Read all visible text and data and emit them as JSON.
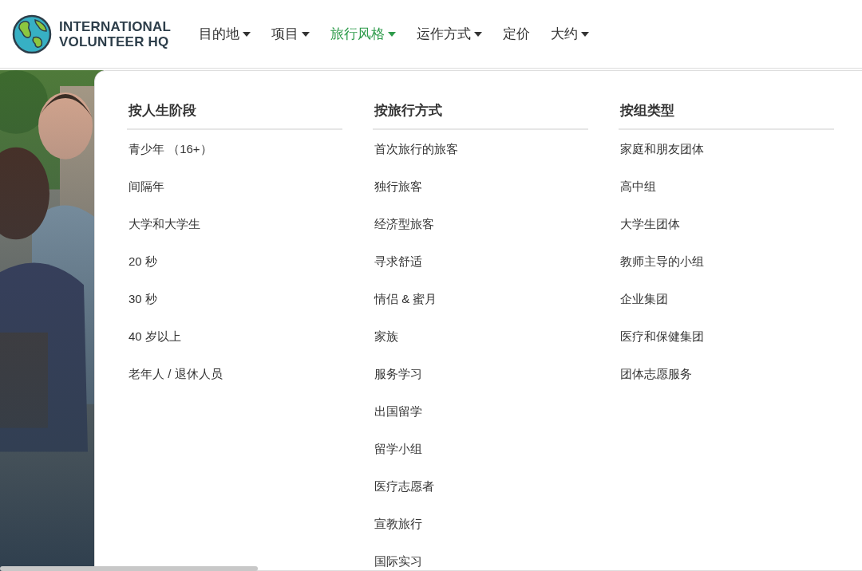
{
  "logo": {
    "line_1": "INTERNATIONAL",
    "line_2": "VOLUNTEER HQ"
  },
  "nav": [
    {
      "label": "目的地",
      "has_dropdown": true,
      "selected": false
    },
    {
      "label": "项目",
      "has_dropdown": true,
      "selected": false
    },
    {
      "label": "旅行风格",
      "has_dropdown": true,
      "selected": true
    },
    {
      "label": "运作方式",
      "has_dropdown": true,
      "selected": false
    },
    {
      "label": "定价",
      "has_dropdown": false,
      "selected": false
    },
    {
      "label": "大约",
      "has_dropdown": true,
      "selected": false
    }
  ],
  "dropdown": {
    "columns": [
      {
        "heading": "按人生阶段",
        "items": [
          "青少年 （16+）",
          "间隔年",
          "大学和大学生",
          "20 秒",
          "30 秒",
          "40 岁以上",
          "老年人 / 退休人员"
        ]
      },
      {
        "heading": "按旅行方式",
        "items": [
          "首次旅行的旅客",
          "独行旅客",
          "经济型旅客",
          "寻求舒适",
          "情侣 & 蜜月",
          "家族",
          "服务学习",
          "出国留学",
          "留学小组",
          "医疗志愿者",
          "宣教旅行",
          "国际实习"
        ]
      },
      {
        "heading": "按组类型",
        "items": [
          "家庭和朋友团体",
          "高中组",
          "大学生团体",
          "教师主导的小组",
          "企业集团",
          "医疗和保健集团",
          "团体志愿服务"
        ]
      }
    ]
  }
}
